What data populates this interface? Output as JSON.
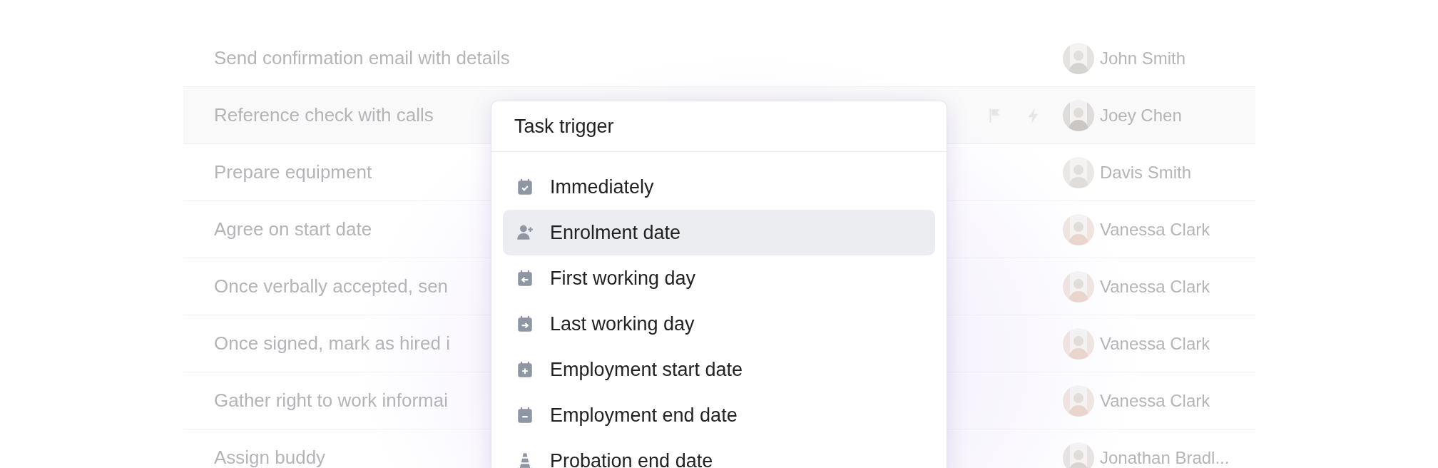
{
  "tasks": [
    {
      "title": "Send confirmation email with details",
      "assignee": "John Smith",
      "highlighted": false
    },
    {
      "title": "Reference check with calls",
      "assignee": "Joey Chen",
      "highlighted": true
    },
    {
      "title": "Prepare equipment",
      "assignee": "Davis Smith",
      "highlighted": false
    },
    {
      "title": "Agree on start date",
      "assignee": "Vanessa Clark",
      "highlighted": false
    },
    {
      "title": "Once verbally accepted, sen",
      "assignee": "Vanessa Clark",
      "highlighted": false
    },
    {
      "title": "Once signed, mark as hired i",
      "assignee": "Vanessa Clark",
      "highlighted": false
    },
    {
      "title": "Gather right to work informai",
      "assignee": "Vanessa Clark",
      "highlighted": false
    },
    {
      "title": "Assign buddy",
      "assignee": "Jonathan Bradl...",
      "highlighted": false
    }
  ],
  "trigger_menu": {
    "title": "Task trigger",
    "items": [
      {
        "label": "Immediately",
        "selected": false
      },
      {
        "label": "Enrolment date",
        "selected": true
      },
      {
        "label": "First working day",
        "selected": false
      },
      {
        "label": "Last working day",
        "selected": false
      },
      {
        "label": "Employment start date",
        "selected": false
      },
      {
        "label": "Employment end date",
        "selected": false
      },
      {
        "label": "Probation end date",
        "selected": false
      }
    ]
  }
}
